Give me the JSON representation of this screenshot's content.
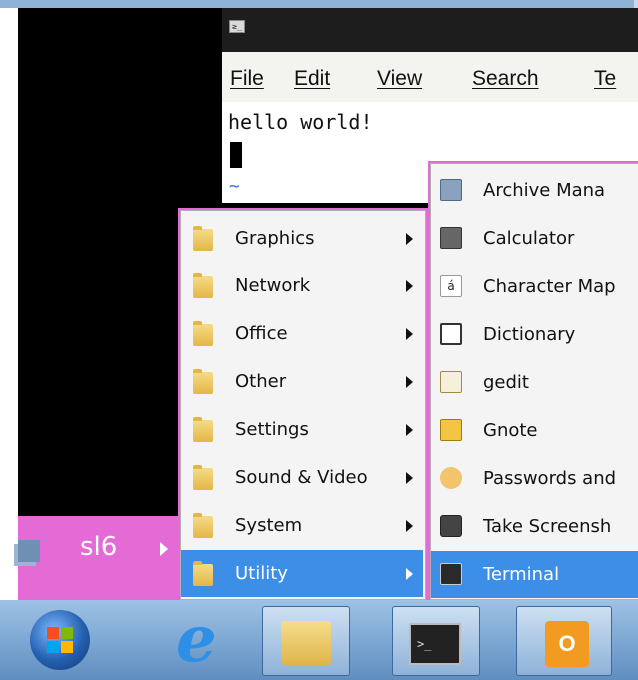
{
  "terminal": {
    "title_icon_glyph": "≥_",
    "menu": [
      {
        "label": "File"
      },
      {
        "label": "Edit"
      },
      {
        "label": "View"
      },
      {
        "label": "Search"
      },
      {
        "label": "Te"
      }
    ],
    "output_line": "hello world!",
    "tilde": "~"
  },
  "launcher": {
    "label": "sl6"
  },
  "left_menu": {
    "items": [
      {
        "label": "Graphics",
        "icon": "folder-icon",
        "has_submenu": true
      },
      {
        "label": "Network",
        "icon": "folder-icon",
        "has_submenu": true
      },
      {
        "label": "Office",
        "icon": "folder-icon",
        "has_submenu": true
      },
      {
        "label": "Other",
        "icon": "folder-icon",
        "has_submenu": true
      },
      {
        "label": "Settings",
        "icon": "folder-icon",
        "has_submenu": true
      },
      {
        "label": "Sound & Video",
        "icon": "folder-icon",
        "has_submenu": true
      },
      {
        "label": "System",
        "icon": "folder-icon",
        "has_submenu": true
      },
      {
        "label": "Utility",
        "icon": "folder-icon",
        "has_submenu": true,
        "selected": true
      }
    ]
  },
  "right_menu": {
    "items": [
      {
        "label": "Archive Mana",
        "icon": "archive-manager-icon"
      },
      {
        "label": "Calculator",
        "icon": "calculator-icon"
      },
      {
        "label": "Character Map",
        "icon": "character-map-icon",
        "glyph": "á"
      },
      {
        "label": "Dictionary",
        "icon": "dictionary-icon"
      },
      {
        "label": "gedit",
        "icon": "gedit-icon"
      },
      {
        "label": "Gnote",
        "icon": "gnote-icon"
      },
      {
        "label": "Passwords and",
        "icon": "key-icon"
      },
      {
        "label": "Take Screensh",
        "icon": "camera-icon"
      },
      {
        "label": "Terminal",
        "icon": "terminal-icon",
        "selected": true
      }
    ]
  },
  "taskbar": {
    "buttons": [
      {
        "name": "start-button",
        "icon": "windows-start-icon"
      },
      {
        "name": "internet-explorer",
        "icon": "internet-explorer-icon"
      },
      {
        "name": "windows-explorer",
        "icon": "folder-library-icon"
      },
      {
        "name": "terminal",
        "icon": "terminal-icon"
      },
      {
        "name": "outlook",
        "icon": "outlook-icon",
        "glyph": "O"
      }
    ]
  },
  "colors": {
    "highlight": "#3c8ee6",
    "launcher_pink": "#e46bd5",
    "menu_bg": "#f4f4f4"
  }
}
